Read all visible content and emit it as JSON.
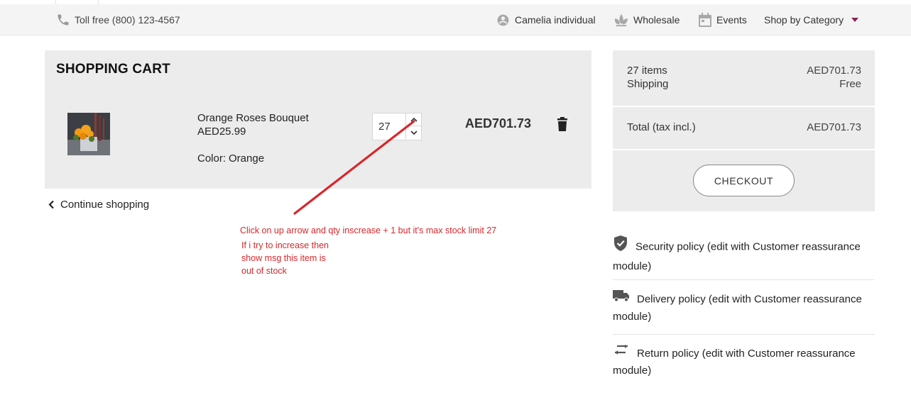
{
  "topbar": {
    "phone_label": "Toll free (800) 123-4567",
    "nav": {
      "camelia": "Camelia individual",
      "wholesale": "Wholesale",
      "events": "Events",
      "shop_by_category": "Shop by Category"
    }
  },
  "cart": {
    "title": "SHOPPING CART",
    "item": {
      "name": "Orange Roses Bouquet",
      "unit_price": "AED25.99",
      "attribute_label": "Color:",
      "attribute_value": "Orange",
      "quantity": "27",
      "line_total": "AED701.73"
    },
    "continue_label": "Continue shopping"
  },
  "summary": {
    "items_label": "27 items",
    "items_value": "AED701.73",
    "shipping_label": "Shipping",
    "shipping_value": "Free",
    "total_label": "Total (tax incl.)",
    "total_value": "AED701.73",
    "checkout_label": "CHECKOUT"
  },
  "reassurance": [
    {
      "icon": "shield-check-icon",
      "text": "Security policy (edit with Customer reassurance module)"
    },
    {
      "icon": "truck-icon",
      "text": "Delivery policy (edit with Customer reassurance module)"
    },
    {
      "icon": "swap-arrows-icon",
      "text": "Return policy (edit with Customer reassurance module)"
    }
  ],
  "annotation": {
    "line1": "Click on up arrow and qty inscrease + 1 but it's max  stock limit 27",
    "line2": "If i try to increase then",
    "line3": "show msg this item is",
    "line4": "out of stock",
    "color": "#d9262b"
  },
  "colors": {
    "accent_caret": "#8c2357",
    "panel_bg": "#ececec",
    "topbar_bg": "#f4f4f4"
  }
}
